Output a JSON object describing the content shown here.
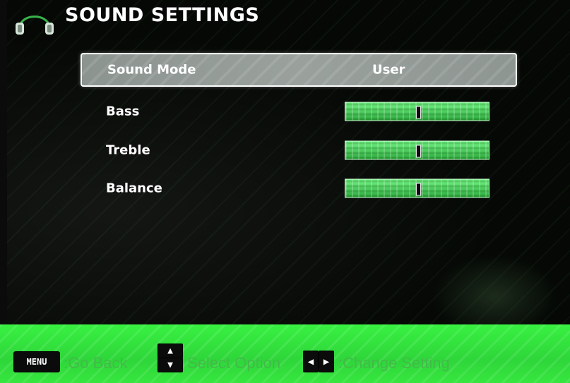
{
  "header": {
    "title": "SOUND SETTINGS",
    "icon": "headphones-icon"
  },
  "menu": {
    "items": [
      {
        "label": "Sound Mode",
        "value": "User",
        "selected": true
      },
      {
        "label": "Bass",
        "level": 0.5
      },
      {
        "label": "Treble",
        "level": 0.5
      },
      {
        "label": "Balance",
        "level": 0.5
      }
    ]
  },
  "help_bar": {
    "menu_key": "MENU",
    "menu_text": ":Go Back",
    "select_icon": "up-down-arrows-icon",
    "select_text": "Select Option",
    "change_icon": "left-right-arrows-icon",
    "change_text": ":Change Setting"
  },
  "colors": {
    "help_bar_green": "#36e63e",
    "slider_green": "#72f284",
    "selected_bg": "#9aa19d",
    "text": "#ffffff"
  }
}
